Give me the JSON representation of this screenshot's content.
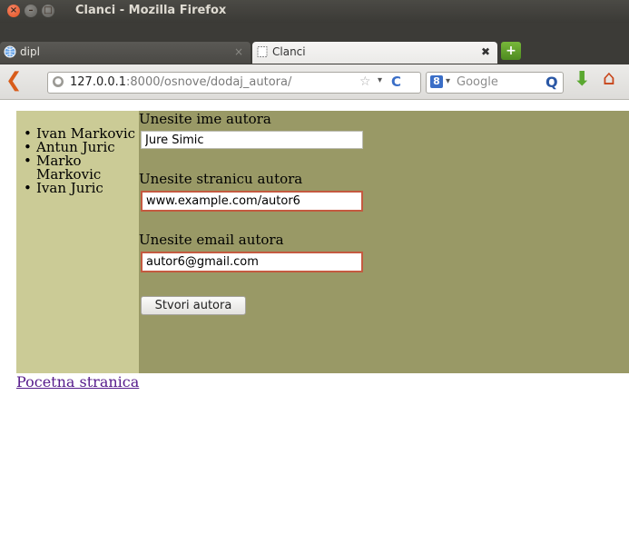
{
  "window": {
    "title": "Clanci - Mozilla Firefox",
    "close_glyph": "×",
    "min_glyph": "–",
    "max_glyph": "□"
  },
  "tabs": [
    {
      "label": "dipl",
      "icon": "globe-tab-icon",
      "close": "×"
    },
    {
      "label": "Clanci",
      "icon": "blank-page-icon",
      "close": "✖"
    }
  ],
  "toolbar": {
    "new_tab_glyph": "+",
    "back_glyph": "❮",
    "url_host": "127.0.0.1",
    "url_rest": ":8000/osnove/dodaj_autora/",
    "star_glyph": "☆",
    "dropdown_glyph": "▾",
    "reload_glyph": "C",
    "search_engine_glyph": "8",
    "search_placeholder": "Google",
    "search_button_glyph": "Q",
    "download_glyph": "⬇",
    "home_glyph": "⌂"
  },
  "sidebar": {
    "authors": [
      "Ivan Markovic",
      "Antun Juric",
      "Marko Markovic",
      "Ivan Juric"
    ]
  },
  "form": {
    "name_label": "Unesite ime autora",
    "name_value": "Jure Simic",
    "page_label": "Unesite stranicu autora",
    "page_value": "www.example.com/autor6",
    "email_label": "Unesite email autora",
    "email_value": "autor6@gmail.com",
    "submit_label": "Stvori autora"
  },
  "footer": {
    "home_link": "Pocetna stranica"
  },
  "colors": {
    "sidebar_bg": "#cbcb96",
    "main_bg": "#999966",
    "link": "#551a8b",
    "error_border": "#c45a40"
  }
}
